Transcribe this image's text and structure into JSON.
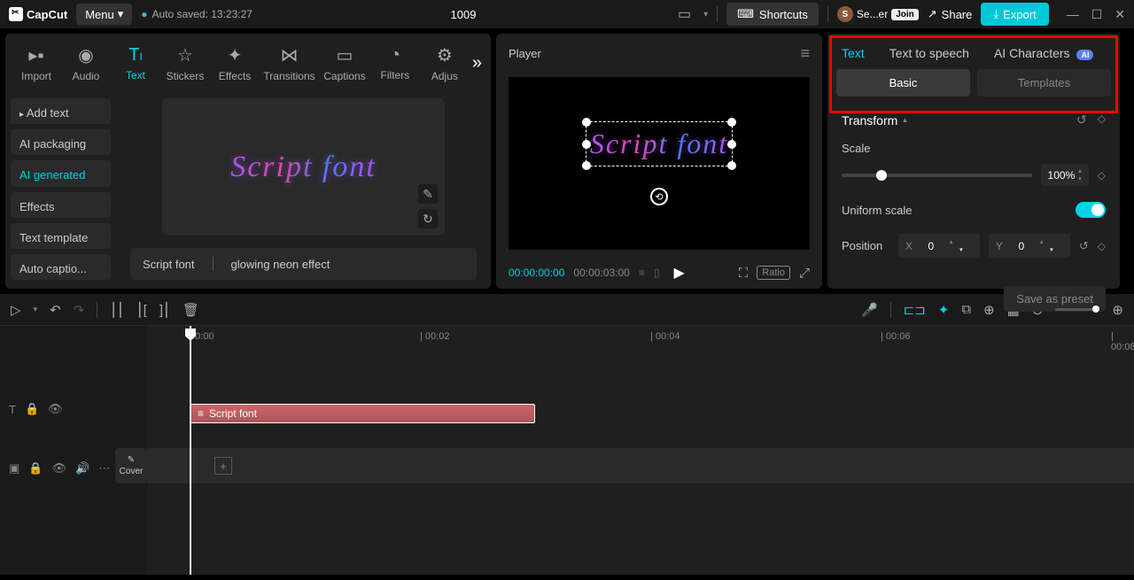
{
  "app": {
    "name": "CapCut"
  },
  "topbar": {
    "menu_label": "Menu",
    "autosave": "Auto saved: 13:23:27",
    "title": "1009",
    "shortcuts": "Shortcuts",
    "user": "Se...er",
    "join": "Join",
    "share": "Share",
    "export": "Export"
  },
  "media_tabs": {
    "import": "Import",
    "audio": "Audio",
    "text": "Text",
    "stickers": "Stickers",
    "effects": "Effects",
    "transitions": "Transitions",
    "captions": "Captions",
    "filters": "Filters",
    "adjust": "Adjus"
  },
  "sidebar": {
    "add_text": "Add text",
    "ai_packaging": "AI packaging",
    "ai_generated": "AI generated",
    "effects": "Effects",
    "text_template": "Text template",
    "auto_captions": "Auto captio..."
  },
  "preview": {
    "text": "Script font",
    "tag1": "Script font",
    "tag2": "glowing neon effect"
  },
  "player": {
    "label": "Player",
    "cur_time": "00:00:00:00",
    "total_time": "00:00:03:00",
    "ratio": "Ratio"
  },
  "right": {
    "tab_text": "Text",
    "tab_tts": "Text to speech",
    "tab_ai": "AI Characters",
    "ai_badge": "AI",
    "sub_basic": "Basic",
    "sub_templates": "Templates",
    "transform": "Transform",
    "scale_label": "Scale",
    "scale_value": "100%",
    "uniform": "Uniform scale",
    "position": "Position",
    "x_label": "X",
    "x_value": "0",
    "y_label": "Y",
    "y_value": "0",
    "save_preset": "Save as preset"
  },
  "timeline": {
    "ruler": [
      "00:00",
      "| 00:02",
      "| 00:04",
      "| 00:06",
      "| 00:08"
    ],
    "clip_label": "Script font",
    "cover": "Cover"
  }
}
